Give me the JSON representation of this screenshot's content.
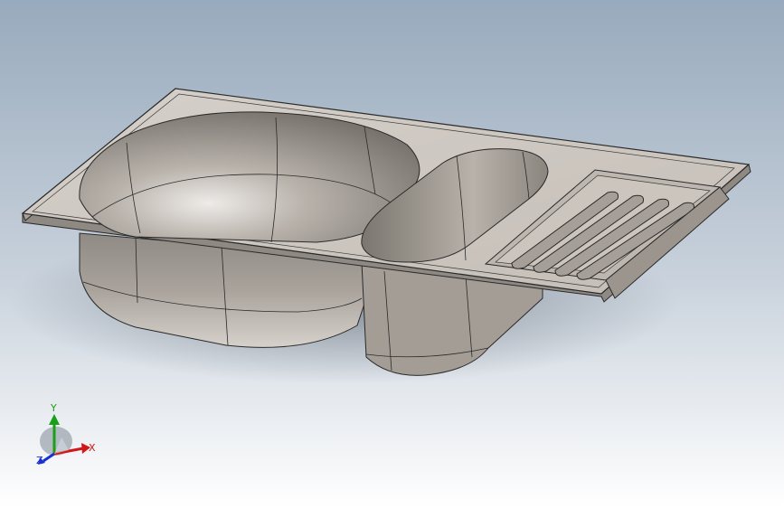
{
  "viewport": {
    "background_top": "#9aabbe",
    "background_bottom": "#ffffff",
    "model_color": "#c9c3bc",
    "edge_color": "#2a2a2a"
  },
  "triad": {
    "x_label": "X",
    "y_label": "Y",
    "z_label": "Z",
    "x_color": "#d01818",
    "y_color": "#18a018",
    "z_color": "#1830d0"
  }
}
